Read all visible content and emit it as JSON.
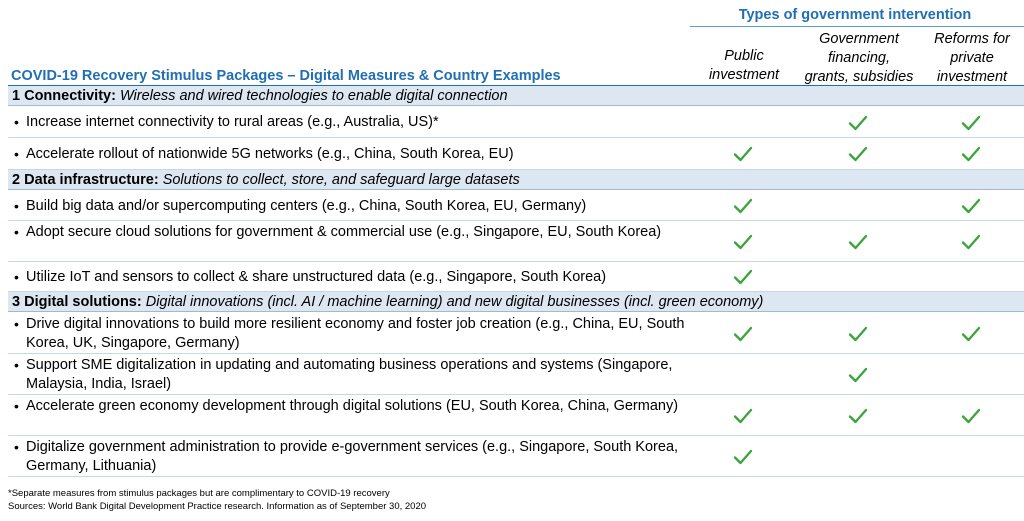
{
  "header": {
    "types_title": "Types of government intervention",
    "columns": [
      {
        "lines": [
          "Public",
          "investment"
        ]
      },
      {
        "lines": [
          "Government",
          "financing,",
          "grants, subsidies"
        ]
      },
      {
        "lines": [
          "Reforms for",
          "private",
          "investment"
        ]
      }
    ],
    "table_title": "COVID-19 Recovery Stimulus Packages – Digital Measures & Country Examples"
  },
  "sections": [
    {
      "title": "1 Connectivity:",
      "subtitle": "Wireless and wired technologies to enable digital connection",
      "rows": [
        {
          "text": "Increase internet connectivity to rural areas (e.g., Australia, US)*",
          "checks": [
            false,
            true,
            true
          ]
        },
        {
          "text": "Accelerate rollout of nationwide 5G networks (e.g., China, South Korea, EU)",
          "checks": [
            true,
            true,
            true
          ]
        }
      ]
    },
    {
      "title": "2 Data infrastructure:",
      "subtitle": "Solutions to collect, store, and safeguard large datasets",
      "rows": [
        {
          "text": "Build big data and/or supercomputing centers (e.g., China, South Korea, EU, Germany)",
          "checks": [
            true,
            false,
            true
          ]
        },
        {
          "text": "Adopt secure cloud solutions for government & commercial use (e.g., Singapore, EU, South Korea)",
          "checks": [
            true,
            true,
            true
          ]
        },
        {
          "text": "Utilize IoT and sensors to collect & share unstructured data (e.g., Singapore, South Korea)",
          "checks": [
            true,
            false,
            false
          ]
        }
      ]
    },
    {
      "title": "3 Digital solutions:",
      "subtitle": "Digital innovations (incl. AI / machine learning) and new digital businesses (incl. green economy)",
      "rows": [
        {
          "text": "Drive digital innovations to build more resilient economy and foster job creation (e.g., China, EU, South Korea, UK, Singapore, Germany)",
          "checks": [
            true,
            true,
            true
          ]
        },
        {
          "text": "Support SME digitalization in updating and automating business operations and systems (Singapore, Malaysia, India, Israel)",
          "checks": [
            false,
            true,
            false
          ]
        },
        {
          "text": "Accelerate green economy development through digital solutions (EU, South Korea, China, Germany)",
          "checks": [
            true,
            true,
            true
          ]
        },
        {
          "text": "Digitalize government administration to provide e-government services (e.g., Singapore, South Korea, Germany, Lithuania)",
          "checks": [
            true,
            false,
            false
          ]
        }
      ]
    }
  ],
  "footnotes": {
    "note": "*Separate measures from stimulus packages but are complimentary to COVID-19 recovery",
    "sources": "Sources: World Bank Digital Development Practice research. Information as of September 30, 2020"
  },
  "colors": {
    "check": "#3aa53a",
    "accent": "#1f6fb2",
    "section_bg": "#dde7f1"
  }
}
